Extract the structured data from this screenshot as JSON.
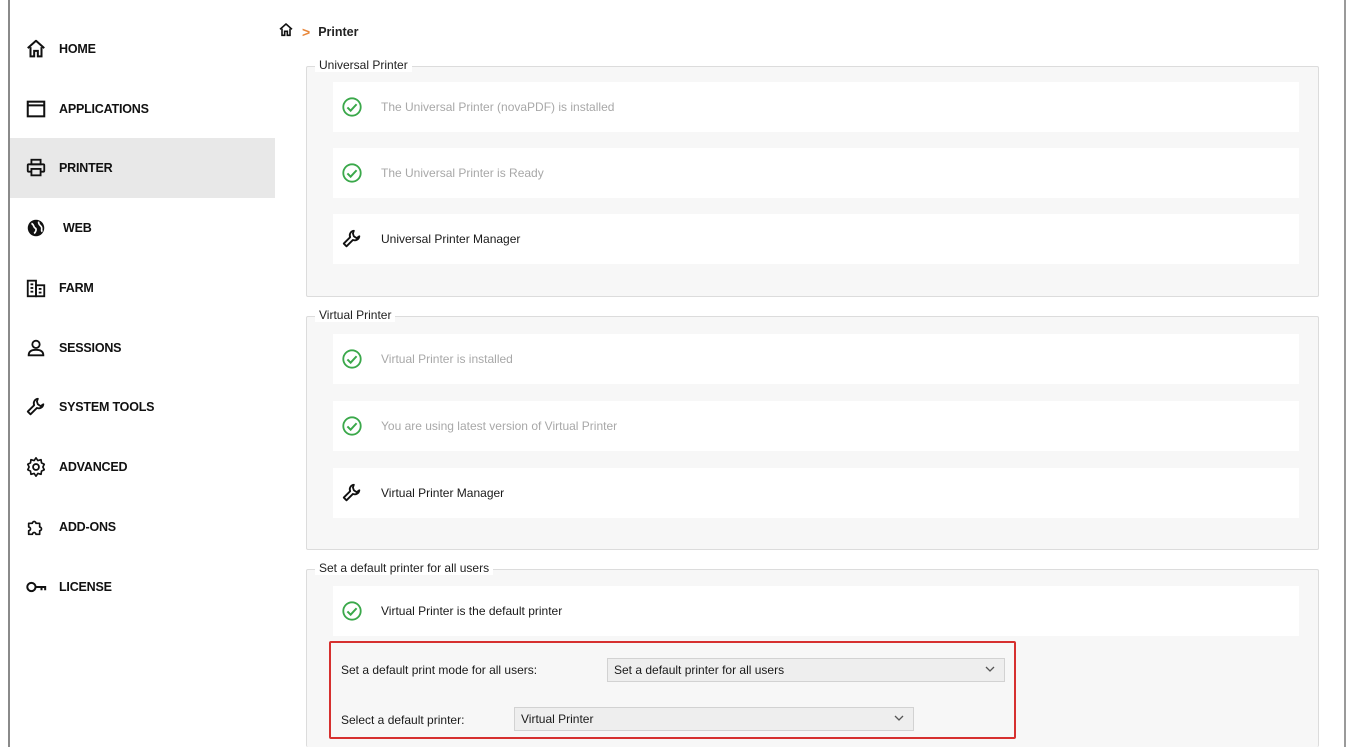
{
  "sidebar": {
    "items": [
      {
        "label": "HOME",
        "icon": "home-icon"
      },
      {
        "label": "APPLICATIONS",
        "icon": "window-icon"
      },
      {
        "label": "PRINTER",
        "icon": "printer-icon",
        "active": true
      },
      {
        "label": "WEB",
        "icon": "globe-icon"
      },
      {
        "label": "FARM",
        "icon": "building-icon"
      },
      {
        "label": "SESSIONS",
        "icon": "user-icon"
      },
      {
        "label": "SYSTEM TOOLS",
        "icon": "wrench-icon"
      },
      {
        "label": "ADVANCED",
        "icon": "gear-icon"
      },
      {
        "label": "ADD-ONS",
        "icon": "puzzle-icon"
      },
      {
        "label": "LICENSE",
        "icon": "key-icon"
      }
    ]
  },
  "breadcrumb": {
    "home_icon": "home-icon",
    "separator": ">",
    "current": "Printer"
  },
  "universal": {
    "title": "Universal Printer",
    "rows": [
      {
        "text": "The Universal Printer (novaPDF) is installed",
        "icon": "check-circle-icon"
      },
      {
        "text": "The Universal Printer is Ready",
        "icon": "check-circle-icon"
      },
      {
        "text": "Universal Printer Manager",
        "icon": "wrench-icon"
      }
    ]
  },
  "virtual": {
    "title": "Virtual Printer",
    "rows": [
      {
        "text": "Virtual Printer is installed",
        "icon": "check-circle-icon"
      },
      {
        "text": "You are using latest version of Virtual Printer",
        "icon": "check-circle-icon"
      },
      {
        "text": "Virtual Printer Manager",
        "icon": "wrench-icon"
      }
    ]
  },
  "default_printer": {
    "title": "Set a default printer for all users",
    "status": {
      "text": "Virtual Printer is the default printer",
      "icon": "check-circle-icon"
    },
    "mode_label": "Set a default print mode for all users:",
    "mode_value": "Set a default printer for all users",
    "printer_label": "Select a default printer:",
    "printer_value": "Virtual Printer"
  },
  "colors": {
    "accent_check": "#3aa84a",
    "highlight_border": "#d6302f",
    "breadcrumb_sep": "#e8873a",
    "active_nav_bg": "#e8e8e8"
  }
}
